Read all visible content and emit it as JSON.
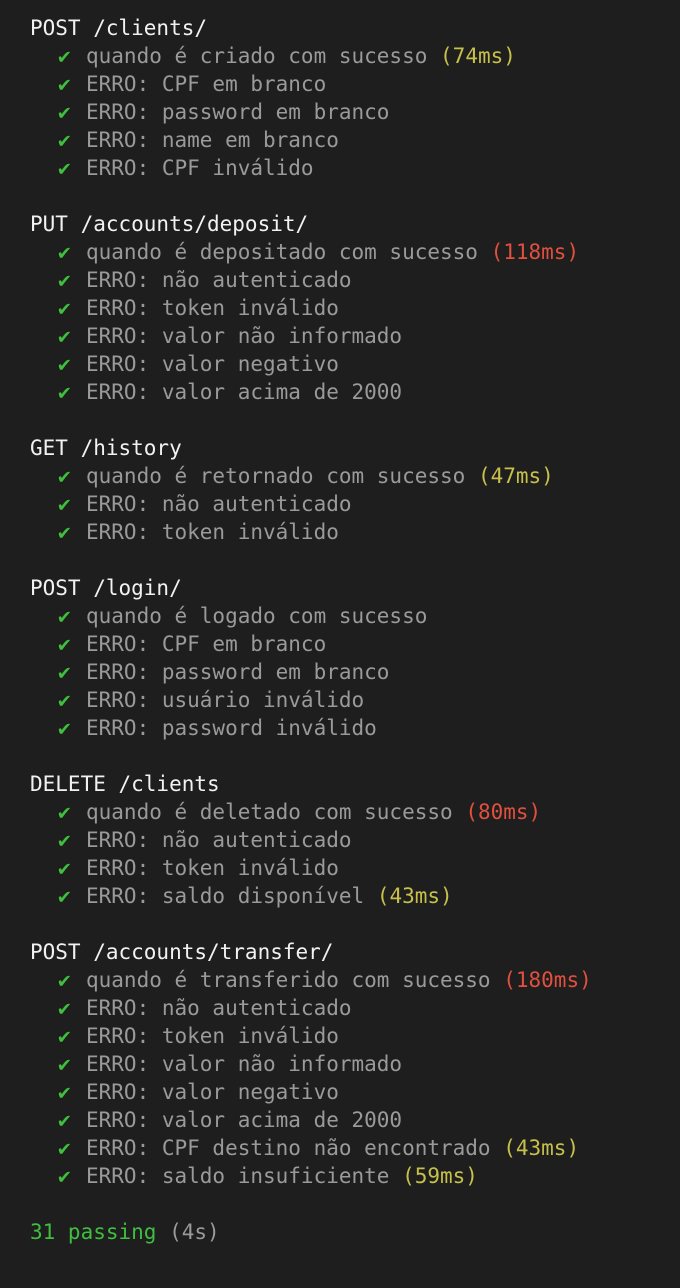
{
  "colors": {
    "background": "#1e1e1e",
    "title": "#f2f2f2",
    "text": "#9a9a9a",
    "check": "#3fbe3f",
    "medium": "#c7c04a",
    "slow": "#e0503e"
  },
  "check_glyph": "✔",
  "suites": [
    {
      "title": "POST /clients/",
      "tests": [
        {
          "text": "quando é criado com sucesso",
          "duration": "(74ms)",
          "speed": "medium"
        },
        {
          "text": "ERRO: CPF em branco"
        },
        {
          "text": "ERRO: password em branco"
        },
        {
          "text": "ERRO: name em branco"
        },
        {
          "text": "ERRO: CPF inválido"
        }
      ]
    },
    {
      "title": "PUT /accounts/deposit/",
      "tests": [
        {
          "text": "quando é depositado com sucesso",
          "duration": "(118ms)",
          "speed": "slow"
        },
        {
          "text": "ERRO: não autenticado"
        },
        {
          "text": "ERRO: token inválido"
        },
        {
          "text": "ERRO: valor não informado"
        },
        {
          "text": "ERRO: valor negativo"
        },
        {
          "text": "ERRO: valor acima de 2000"
        }
      ]
    },
    {
      "title": "GET /history",
      "tests": [
        {
          "text": "quando é retornado com sucesso",
          "duration": "(47ms)",
          "speed": "medium"
        },
        {
          "text": "ERRO: não autenticado"
        },
        {
          "text": "ERRO: token inválido"
        }
      ]
    },
    {
      "title": "POST /login/",
      "tests": [
        {
          "text": "quando é logado com sucesso"
        },
        {
          "text": "ERRO: CPF em branco"
        },
        {
          "text": "ERRO: password em branco"
        },
        {
          "text": "ERRO: usuário inválido"
        },
        {
          "text": "ERRO: password inválido"
        }
      ]
    },
    {
      "title": "DELETE /clients",
      "tests": [
        {
          "text": "quando é deletado com sucesso",
          "duration": "(80ms)",
          "speed": "slow"
        },
        {
          "text": "ERRO: não autenticado"
        },
        {
          "text": "ERRO: token inválido"
        },
        {
          "text": "ERRO: saldo disponível",
          "duration": "(43ms)",
          "speed": "medium"
        }
      ]
    },
    {
      "title": "POST /accounts/transfer/",
      "tests": [
        {
          "text": "quando é transferido com sucesso",
          "duration": "(180ms)",
          "speed": "slow"
        },
        {
          "text": "ERRO: não autenticado"
        },
        {
          "text": "ERRO: token inválido"
        },
        {
          "text": "ERRO: valor não informado"
        },
        {
          "text": "ERRO: valor negativo"
        },
        {
          "text": "ERRO: valor acima de 2000"
        },
        {
          "text": "ERRO: CPF destino não encontrado",
          "duration": "(43ms)",
          "speed": "medium"
        },
        {
          "text": "ERRO: saldo insuficiente",
          "duration": "(59ms)",
          "speed": "medium"
        }
      ]
    }
  ],
  "summary": {
    "passing": "31 passing",
    "time": "(4s)"
  }
}
